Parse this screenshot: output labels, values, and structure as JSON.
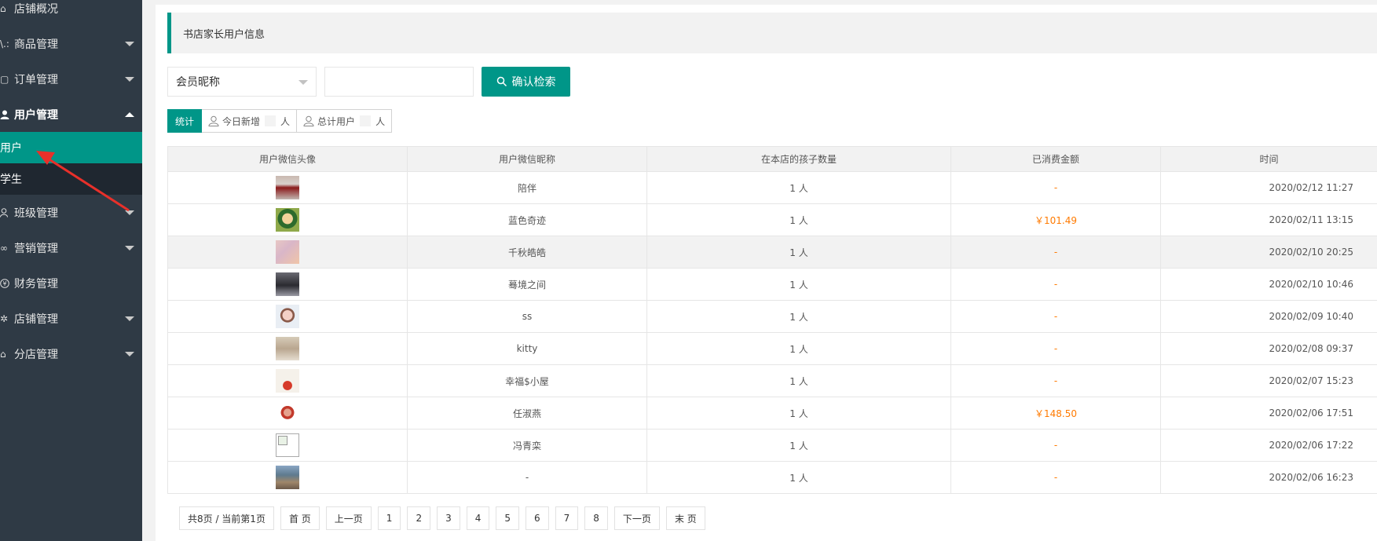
{
  "sidebar": {
    "items": [
      {
        "label": "店铺概况",
        "icon": "home-icon"
      },
      {
        "label": "商品管理",
        "icon": "cart-icon"
      },
      {
        "label": "订单管理",
        "icon": "order-icon"
      },
      {
        "label": "用户管理",
        "icon": "user-icon"
      },
      {
        "label": "班级管理",
        "icon": "class-icon"
      },
      {
        "label": "营销管理",
        "icon": "link-icon"
      },
      {
        "label": "财务管理",
        "icon": "finance-icon"
      },
      {
        "label": "店铺管理",
        "icon": "gear-icon"
      },
      {
        "label": "分店管理",
        "icon": "branch-icon"
      }
    ],
    "sub_items": [
      {
        "label": "用户"
      },
      {
        "label": "学生"
      }
    ]
  },
  "main": {
    "title": "书店家长用户信息",
    "search": {
      "select_value": "会员昵称",
      "input_value": "",
      "button_label": "确认检索"
    },
    "stats": {
      "tag": "统计",
      "today_label": "今日新增",
      "today_suffix": "人",
      "total_label": "总计用户",
      "total_suffix": "人"
    },
    "table": {
      "headers": [
        "用户微信头像",
        "用户微信昵称",
        "在本店的孩子数量",
        "已消费金额",
        "时间"
      ],
      "rows": [
        {
          "nickname": "陪伴",
          "children": "1 人",
          "amount": "-",
          "time": "2020/02/12 11:27",
          "avatar": "av1"
        },
        {
          "nickname": "蓝色奇迹",
          "children": "1 人",
          "amount": "￥101.49",
          "time": "2020/02/11 13:15",
          "avatar": "av2"
        },
        {
          "nickname": "千秋皓皓",
          "children": "1 人",
          "amount": "-",
          "time": "2020/02/10 20:25",
          "avatar": "av3"
        },
        {
          "nickname": "蓦境之间",
          "children": "1 人",
          "amount": "-",
          "time": "2020/02/10 10:46",
          "avatar": "av4"
        },
        {
          "nickname": "ss",
          "children": "1 人",
          "amount": "-",
          "time": "2020/02/09 10:40",
          "avatar": "av5"
        },
        {
          "nickname": "kitty",
          "children": "1 人",
          "amount": "-",
          "time": "2020/02/08 09:37",
          "avatar": "av6"
        },
        {
          "nickname": "幸福$小屋",
          "children": "1 人",
          "amount": "-",
          "time": "2020/02/07 15:23",
          "avatar": "av7"
        },
        {
          "nickname": "任淑燕",
          "children": "1 人",
          "amount": "￥148.50",
          "time": "2020/02/06 17:51",
          "avatar": "av8"
        },
        {
          "nickname": "冯青栾",
          "children": "1 人",
          "amount": "-",
          "time": "2020/02/06 17:22",
          "avatar": "broken"
        },
        {
          "nickname": "-",
          "children": "1 人",
          "amount": "-",
          "time": "2020/02/06 16:23",
          "avatar": "av10"
        }
      ]
    },
    "pager": {
      "summary": "共8页 / 当前第1页",
      "first": "首 页",
      "prev": "上一页",
      "pages": [
        "1",
        "2",
        "3",
        "4",
        "5",
        "6",
        "7",
        "8"
      ],
      "next": "下一页",
      "last": "末 页"
    }
  },
  "colors": {
    "accent": "#009688",
    "sidebar_bg": "#2f3a45",
    "amount": "#ff7a00",
    "annotation_arrow": "#e8302a"
  }
}
